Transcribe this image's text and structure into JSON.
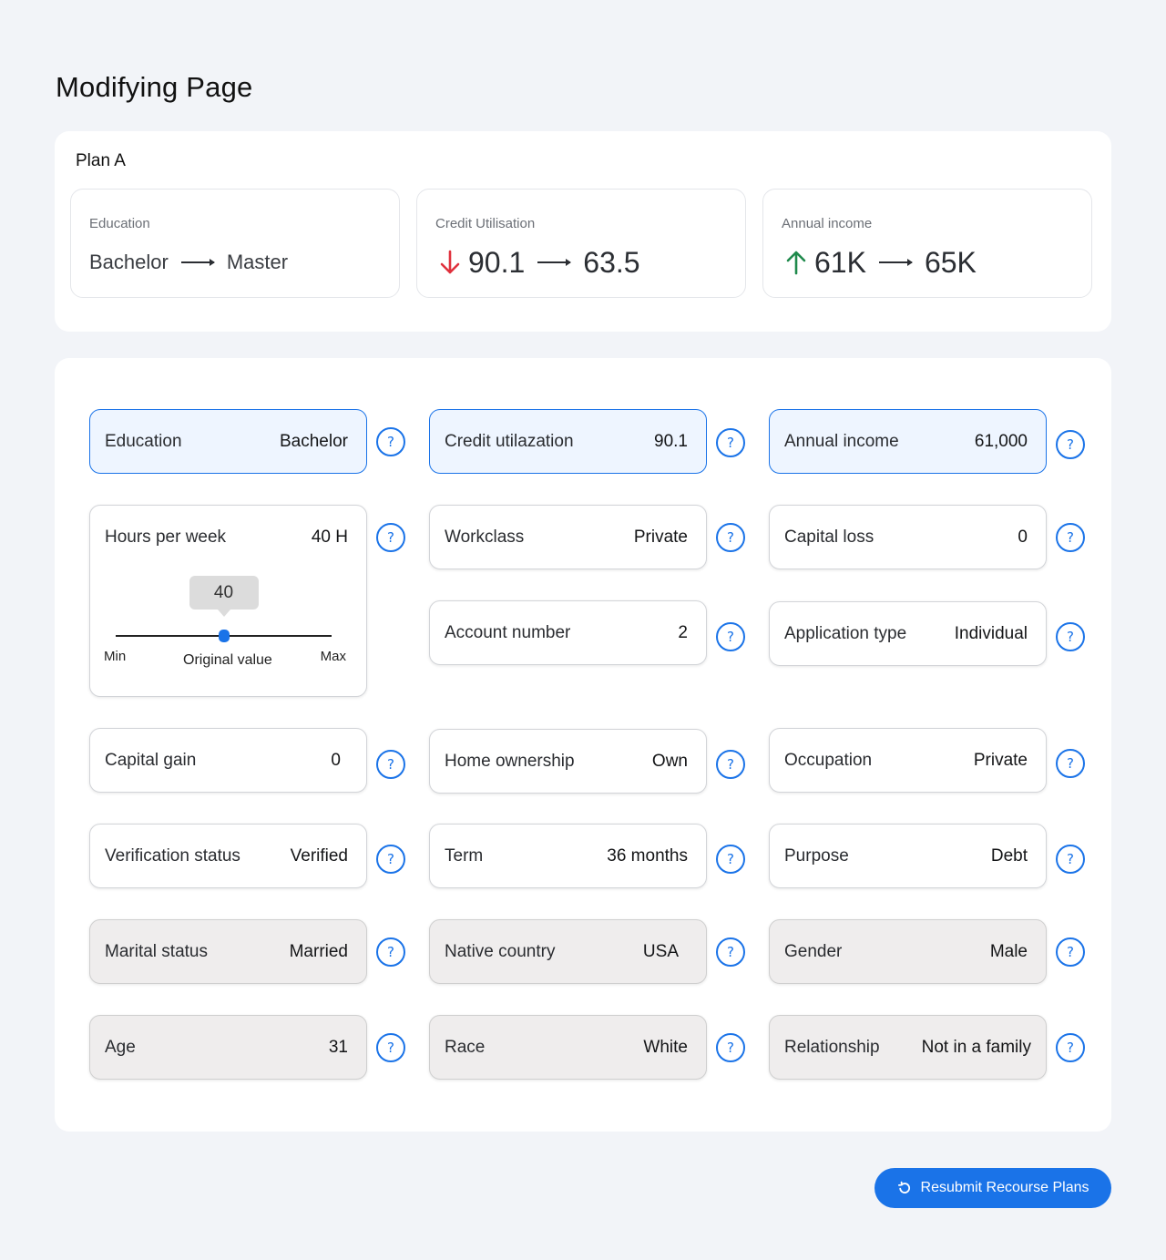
{
  "page": {
    "title": "Modifying Page"
  },
  "plan": {
    "title": "Plan A",
    "changes": [
      {
        "label": "Education",
        "from": "Bachelor",
        "to": "Master",
        "trend": "none"
      },
      {
        "label": "Credit Utilisation",
        "from": "90.1",
        "to": "63.5",
        "trend": "down"
      },
      {
        "label": "Annual income",
        "from": "61K",
        "to": "65K",
        "trend": "up"
      }
    ]
  },
  "colors": {
    "accent": "#1a73e8",
    "down": "#e0313d",
    "up": "#1f8a4c"
  },
  "fields": {
    "education": {
      "label": "Education",
      "value": "Bachelor"
    },
    "credit_utilization": {
      "label": "Credit utilazation",
      "value": "90.1"
    },
    "annual_income": {
      "label": "Annual income",
      "value": "61,000"
    },
    "hours_per_week": {
      "label": "Hours per week",
      "value": "40 H",
      "slider_value": "40",
      "min_label": "Min",
      "max_label": "Max",
      "original_label": "Original value",
      "fraction": 0.5
    },
    "workclass": {
      "label": "Workclass",
      "value": "Private"
    },
    "capital_loss": {
      "label": "Capital loss",
      "value": "0"
    },
    "account_number": {
      "label": "Account number",
      "value": "2"
    },
    "application_type": {
      "label": "Application type",
      "value": "Individual"
    },
    "capital_gain": {
      "label": "Capital gain",
      "value": "0"
    },
    "home_ownership": {
      "label": "Home ownership",
      "value": "Own"
    },
    "occupation": {
      "label": "Occupation",
      "value": "Private"
    },
    "verification_status": {
      "label": "Verification status",
      "value": "Verified"
    },
    "term": {
      "label": "Term",
      "value": "36 months"
    },
    "purpose": {
      "label": "Purpose",
      "value": "Debt"
    },
    "marital_status": {
      "label": "Marital status",
      "value": "Married"
    },
    "native_country": {
      "label": "Native country",
      "value": "USA"
    },
    "gender": {
      "label": "Gender",
      "value": "Male"
    },
    "age": {
      "label": "Age",
      "value": "31"
    },
    "race": {
      "label": "Race",
      "value": "White"
    },
    "relationship": {
      "label": "Relationship",
      "value": "Not in a family"
    }
  },
  "help_symbol": "?",
  "actions": {
    "resubmit_label": "Resubmit Recourse Plans",
    "resubmit_icon": "refresh-icon"
  }
}
